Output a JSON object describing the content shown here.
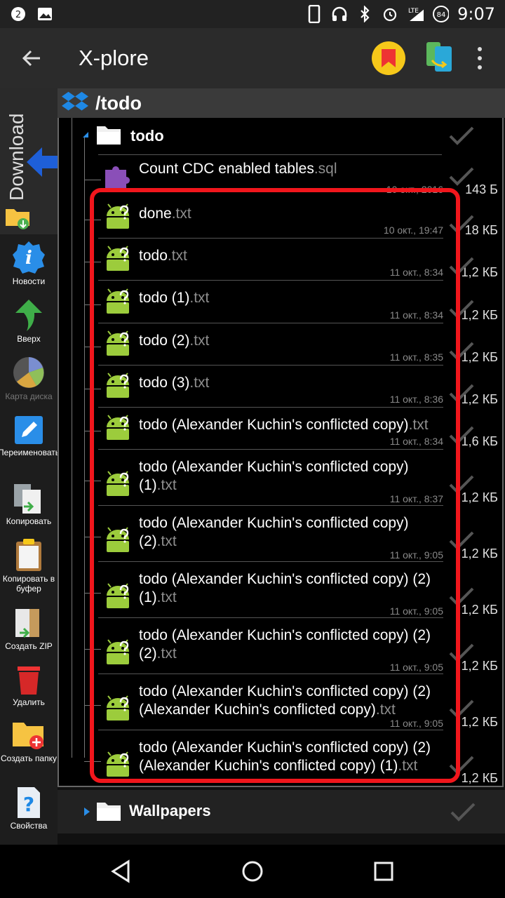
{
  "status_bar": {
    "notif_count": "2",
    "network": "LTE",
    "battery": "84",
    "time": "9:07"
  },
  "app_bar": {
    "title": "X-plore"
  },
  "sidebar": {
    "download_label": "Download",
    "tools": [
      {
        "label": "Новости",
        "enabled": true
      },
      {
        "label": "Вверх",
        "enabled": true
      },
      {
        "label": "Карта диска",
        "enabled": false
      },
      {
        "label": "Переименовать",
        "enabled": true
      },
      {
        "label": "Копировать",
        "enabled": true
      },
      {
        "label": "Копировать в буфер",
        "enabled": true
      },
      {
        "label": "Создать ZIP",
        "enabled": true
      },
      {
        "label": "Удалить",
        "enabled": true
      },
      {
        "label": "Создать папку",
        "enabled": true
      },
      {
        "label": "Свойства",
        "enabled": true
      }
    ]
  },
  "pane": {
    "path": "/todo",
    "folder": "todo",
    "sql_file": {
      "name": "Count CDC enabled tables",
      "ext": ".sql",
      "date": "10 окт., 2016",
      "size": "143 Б"
    },
    "files": [
      {
        "name": "done",
        "ext": ".txt",
        "date": "10 окт., 19:47",
        "size": "18 КБ"
      },
      {
        "name": "todo",
        "ext": ".txt",
        "date": "11 окт., 8:34",
        "size": "1,2 КБ"
      },
      {
        "name": "todo (1)",
        "ext": ".txt",
        "date": "11 окт., 8:34",
        "size": "1,2 КБ"
      },
      {
        "name": "todo (2)",
        "ext": ".txt",
        "date": "11 окт., 8:35",
        "size": "1,2 КБ"
      },
      {
        "name": "todo (3)",
        "ext": ".txt",
        "date": "11 окт., 8:36",
        "size": "1,2 КБ"
      },
      {
        "name": "todo (Alexander Kuchin's conflicted copy)",
        "ext": ".txt",
        "date": "11 окт., 8:34",
        "size": "1,6 КБ"
      },
      {
        "name": "todo (Alexander Kuchin's conflicted copy) (1)",
        "ext": ".txt",
        "date": "11 окт., 8:37",
        "size": "1,2 КБ"
      },
      {
        "name": "todo (Alexander Kuchin's conflicted copy) (2)",
        "ext": ".txt",
        "date": "11 окт., 9:05",
        "size": "1,2 КБ"
      },
      {
        "name": "todo (Alexander Kuchin's conflicted copy) (2) (1)",
        "ext": ".txt",
        "date": "11 окт., 9:05",
        "size": "1,2 КБ"
      },
      {
        "name": "todo (Alexander Kuchin's conflicted copy) (2) (2)",
        "ext": ".txt",
        "date": "11 окт., 9:05",
        "size": "1,2 КБ"
      },
      {
        "name": "todo (Alexander Kuchin's conflicted copy) (2) (Alexander Kuchin's conflicted copy)",
        "ext": ".txt",
        "date": "11 окт., 9:05",
        "size": "1,2 КБ"
      },
      {
        "name": "todo (Alexander Kuchin's conflicted copy) (2) (Alexander Kuchin's conflicted copy) (1)",
        "ext": ".txt",
        "date": "",
        "size": "1,2 КБ"
      }
    ],
    "sibling_folder": "Wallpapers"
  },
  "colors": {
    "highlight": "#f1161c",
    "accent_blue": "#1e88e5",
    "android_green": "#9ccc3c"
  },
  "icons": {
    "back": "arrow-left-icon",
    "bookmark": "bookmark-icon",
    "pane": "pane-switch-icon",
    "overflow": "more-vert-icon",
    "folder": "folder-icon",
    "file_txt": "android-unknown-file-icon",
    "file_sql": "puzzle-icon",
    "check": "check-icon"
  }
}
